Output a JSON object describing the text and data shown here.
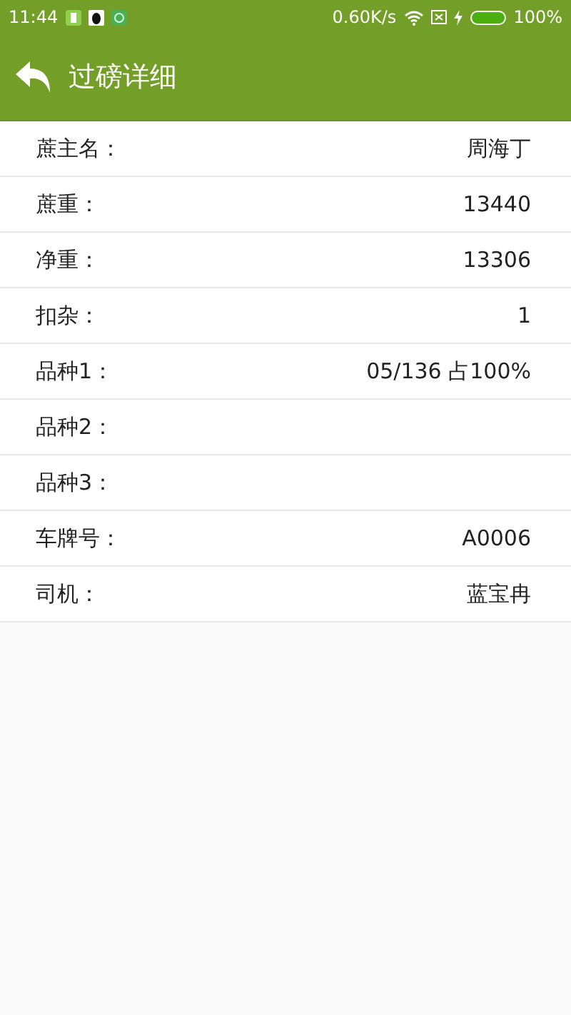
{
  "status_bar": {
    "time": "11:44",
    "speed": "0.60K/s",
    "battery": "100%"
  },
  "app_bar": {
    "title": "过磅详细"
  },
  "rows": [
    {
      "label": "蔗主名：",
      "value": "周海丁"
    },
    {
      "label": "蔗重：",
      "value": "13440"
    },
    {
      "label": "净重：",
      "value": "13306"
    },
    {
      "label": "扣杂：",
      "value": "1"
    },
    {
      "label": "品种1：",
      "value": "05/136 占100%"
    },
    {
      "label": "品种2："
    },
    {
      "label": "品种3："
    },
    {
      "label": "车牌号：",
      "value": "A0006"
    },
    {
      "label": "司机：",
      "value": "蓝宝冉"
    }
  ]
}
